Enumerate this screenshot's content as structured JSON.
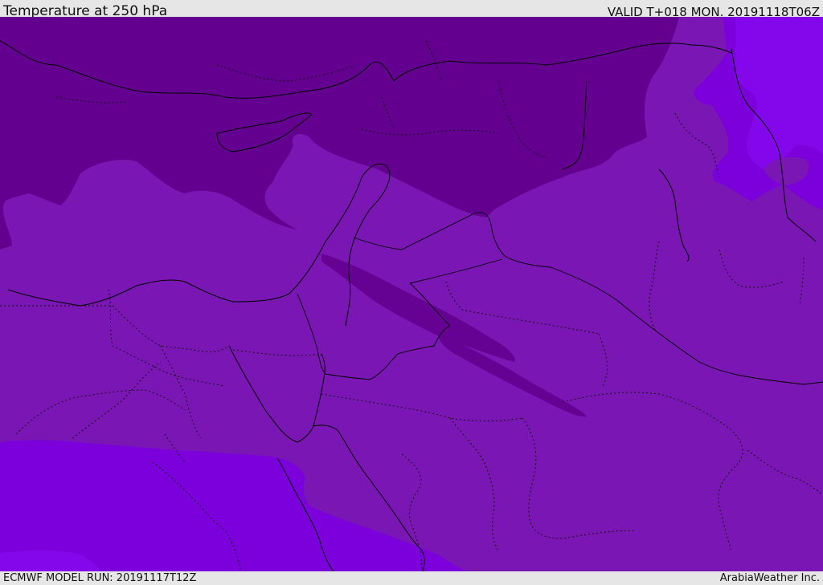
{
  "header": {
    "title": "Temperature at 250 hPa",
    "valid_time": "VALID T+018 MON. 20191118T06Z"
  },
  "footer": {
    "model_run": "ECMWF MODEL RUN: 20191117T12Z",
    "credit": "ArabiaWeather Inc."
  },
  "map": {
    "field": "temperature-250hPa",
    "colors": {
      "coldest": "#63008f",
      "cold": "#7410b0",
      "mid": "#7a17b4",
      "warm": "#7b00db",
      "warmest": "#8406ea",
      "coastline": "#000000",
      "border": "#000000"
    }
  }
}
